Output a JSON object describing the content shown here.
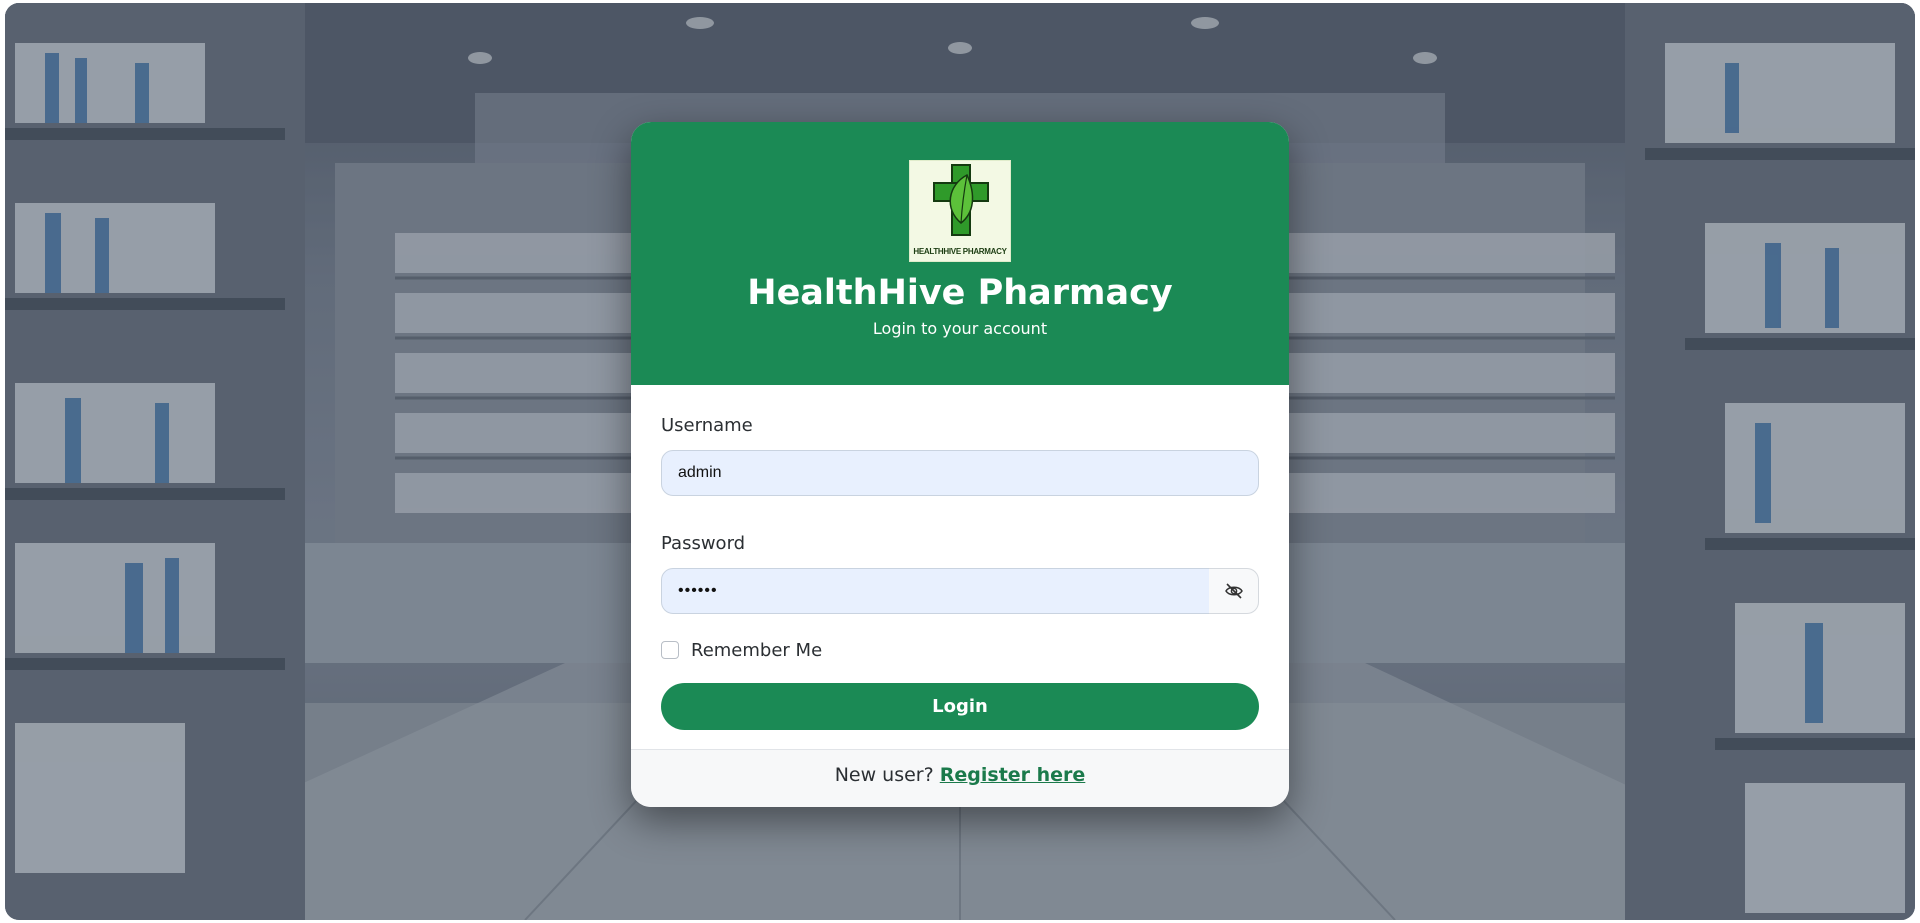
{
  "brand": {
    "logo_text": "HEALTHHIVE PHARMACY",
    "title": "HealthHive Pharmacy",
    "subtitle": "Login to your account"
  },
  "form": {
    "username_label": "Username",
    "username_value": "admin",
    "password_label": "Password",
    "password_value": "••••••",
    "remember_label": "Remember Me",
    "remember_checked": false,
    "login_label": "Login"
  },
  "footer": {
    "prompt": "New user?",
    "register_label": "Register here"
  },
  "icons": {
    "password_toggle": "eye-slash-icon",
    "logo": "green-cross-leaf-icon"
  },
  "colors": {
    "brand_green": "#1b8a55",
    "input_bg": "#e8f0fe",
    "link_green": "#1b7a4b"
  }
}
